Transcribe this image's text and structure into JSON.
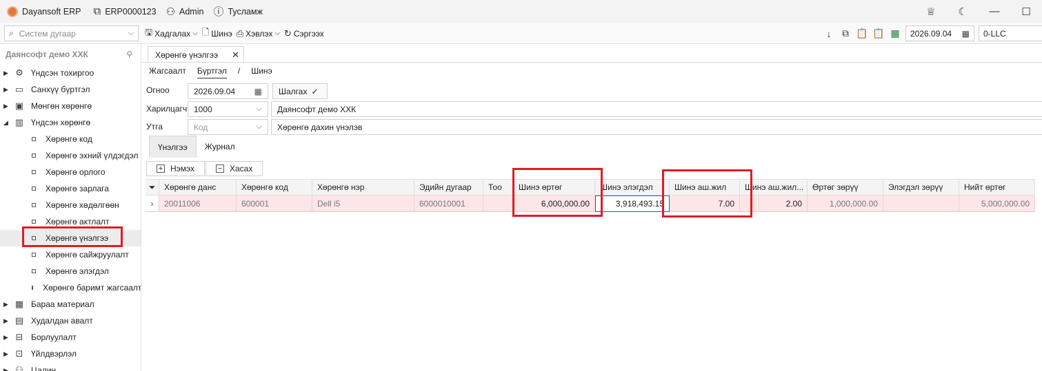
{
  "titlebar": {
    "app_name": "Dayansoft ERP",
    "doc_code": "ERP0000123",
    "user": "Admin",
    "help": "Тусламж"
  },
  "toolbar": {
    "search_placeholder": "Систем дугаар",
    "save": "Хадгалах",
    "new": "Шинэ",
    "print": "Хэвлэх",
    "refresh": "Сэргээх",
    "date": "2026.09.04",
    "company": "0-LLC"
  },
  "sidebar": {
    "header": "Даянсофт демо ХХК",
    "groups": [
      {
        "label": "Үндсэн тохиргоо",
        "icon": "gear-icon"
      },
      {
        "label": "Санхүү бүртгэл",
        "icon": "ledger-icon"
      },
      {
        "label": "Мөнгөн хөрөнгө",
        "icon": "money-icon"
      },
      {
        "label": "Үндсэн хөрөнгө",
        "icon": "building-icon"
      }
    ],
    "subitems": [
      "Хөрөнгө код",
      "Хөрөнгө эхний үлдэгдэл",
      "Хөрөнгө орлого",
      "Хөрөнгө зарлага",
      "Хөрөнгө хөдөлгөөн",
      "Хөрөнгө актлалт",
      "Хөрөнгө үнэлгээ",
      "Хөрөнгө сайжруулалт",
      "Хөрөнгө элэгдэл",
      "Хөрөнгө баримт жагсаалт"
    ],
    "groups_after": [
      {
        "label": "Бараа материал",
        "icon": "box-icon"
      },
      {
        "label": "Худалдан авалт",
        "icon": "cart-icon"
      },
      {
        "label": "Борлуулалт",
        "icon": "cart-icon"
      },
      {
        "label": "Үйлдвэрлэл",
        "icon": "factory-icon"
      },
      {
        "label": "Цалин",
        "icon": "person-icon"
      }
    ]
  },
  "document": {
    "tab_title": "Хөрөнгө үнэлгээ",
    "crumbs": {
      "list": "Жагсаалт",
      "register": "Бүртгэл",
      "sep": "/",
      "new": "Шинэ"
    },
    "date_label": "Огноо",
    "date_value": "2026.09.04",
    "check_button": "Шалгах",
    "partner_label": "Харилцагч",
    "partner_code": "1000",
    "partner_name": "Даянсофт демо ХХК",
    "description_label": "Утга",
    "code_placeholder": "Код",
    "description_value": "Хөрөнгө дахин үнэлэв",
    "tabs": {
      "valuation": "Үнэлгээ",
      "journal": "Журнал"
    },
    "add_button": "Нэмэх",
    "remove_button": "Хасах"
  },
  "grid": {
    "columns": [
      "Хөрөнгө данс",
      "Хөрөнгө код",
      "Хөрөнгө нэр",
      "Эдийн дугаар",
      "Тоо",
      "Шинэ өртөг",
      "Шинэ элэгдэл",
      "Шинэ аш.жил",
      "Шинэ аш.жил...",
      "Өртөг зөрүү",
      "Элэгдэл зөрүү",
      "Нийт өртөг"
    ],
    "rows": [
      {
        "account": "20011006",
        "code": "600001",
        "name": "Dell i5",
        "serial": "6000010001",
        "qty": "",
        "new_cost": "6,000,000.00",
        "new_depr": "3,918,493.15",
        "new_life": "7.00",
        "new_life_rem": "2.00",
        "cost_diff": "1,000,000.00",
        "depr_diff": "",
        "total_cost": "5,000,000.00"
      }
    ]
  }
}
